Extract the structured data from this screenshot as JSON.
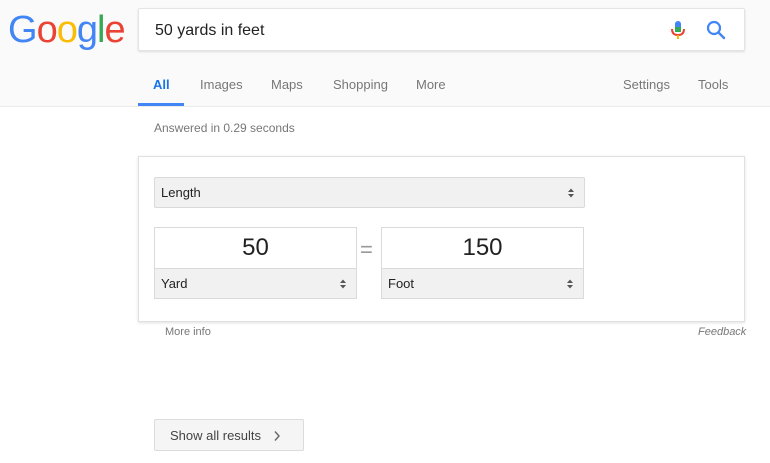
{
  "logo": {
    "letters": [
      {
        "char": "G",
        "color": "#4285F4"
      },
      {
        "char": "o",
        "color": "#EA4335"
      },
      {
        "char": "o",
        "color": "#FBBC05"
      },
      {
        "char": "g",
        "color": "#4285F4"
      },
      {
        "char": "l",
        "color": "#34A853"
      },
      {
        "char": "e",
        "color": "#EA4335"
      }
    ]
  },
  "search": {
    "query": "50 yards in feet",
    "mic_icon": "mic-icon",
    "search_icon": "search-icon"
  },
  "tabs": [
    {
      "label": "All",
      "active": true
    },
    {
      "label": "Images"
    },
    {
      "label": "Maps"
    },
    {
      "label": "Shopping"
    },
    {
      "label": "More"
    },
    {
      "label": "Settings"
    },
    {
      "label": "Tools"
    }
  ],
  "answered": "Answered in 0.29 seconds",
  "converter": {
    "category": "Length",
    "from": {
      "value": "50",
      "unit": "Yard"
    },
    "equals": "=",
    "to": {
      "value": "150",
      "unit": "Foot"
    }
  },
  "footer": {
    "more_info": "More info",
    "feedback": "Feedback"
  },
  "show_all": {
    "label": "Show all results",
    "icon": "chevron-right-icon"
  },
  "colors": {
    "accent": "#4285F4",
    "tab_active": "#1a73e8"
  }
}
